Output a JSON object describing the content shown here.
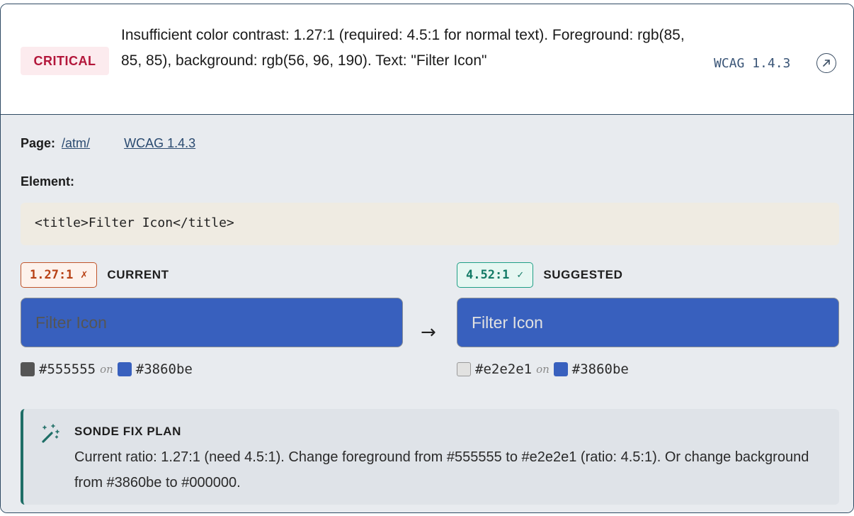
{
  "issue": {
    "severity": "CRITICAL",
    "message": "Insufficient color contrast: 1.27:1 (required: 4.5:1 for normal text). Foreground: rgb(85, 85, 85), background: rgb(56, 96, 190). Text: \"Filter Icon\"",
    "wcag_ref": "WCAG 1.4.3",
    "link_icon": "external-link-icon"
  },
  "details": {
    "page_label": "Page:",
    "page_path": "/atm/",
    "wcag_link": "WCAG 1.4.3",
    "element_label": "Element:",
    "element_code": "<title>Filter Icon</title>"
  },
  "current": {
    "ratio": "1.27:1",
    "mark": "✗",
    "label": "CURRENT",
    "sample_text": "Filter Icon",
    "fg": "#555555",
    "on": "on",
    "bg": "#3860be"
  },
  "suggested": {
    "ratio": "4.52:1",
    "mark": "✓",
    "label": "SUGGESTED",
    "sample_text": "Filter Icon",
    "fg": "#e2e2e1",
    "on": "on",
    "bg": "#3860be"
  },
  "arrow": "→",
  "fix_plan": {
    "icon": "magic-wand-icon",
    "title": "SONDE FIX PLAN",
    "text": "Current ratio: 1.27:1 (need 4.5:1). Change foreground from #555555 to #e2e2e1 (ratio: 4.5:1). Or change background from #3860be to #000000."
  },
  "colors": {
    "critical": "#b3163a",
    "preview_bg": "#3860be",
    "bad_ratio": "#b84216",
    "good_ratio": "#137a66",
    "fix_accent": "#1e6e66"
  }
}
